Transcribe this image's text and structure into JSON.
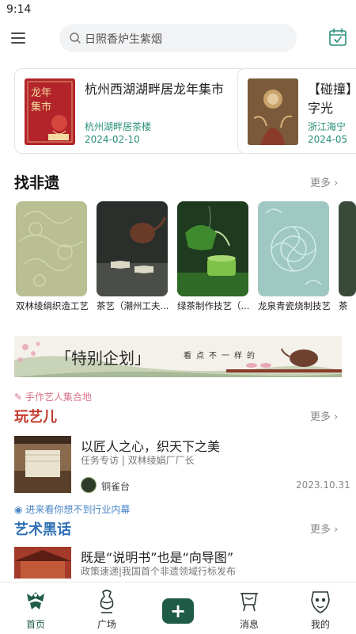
{
  "status_bar": {
    "time": "9:14"
  },
  "search": {
    "placeholder_text": "日照香炉生紫烟"
  },
  "events": [
    {
      "title": "杭州西湖湖畔居龙年集市",
      "venue": "杭州湖畔居茶楼",
      "date": "2024-02-10"
    },
    {
      "title": "【碰撞】数字光",
      "venue": "浙江海宁",
      "date": "2024-05"
    }
  ],
  "heritage": {
    "title": "找非遗",
    "more": "更多",
    "items": [
      {
        "label": "双林绫绢织造工艺"
      },
      {
        "label": "茶艺（潮州工夫..."
      },
      {
        "label": "绿茶制作技艺（..."
      },
      {
        "label": "龙泉青瓷烧制技艺"
      },
      {
        "label": "茶"
      }
    ]
  },
  "banner": {
    "title": "「特别企划」",
    "subtitle": "看点不一样的"
  },
  "craft_section": {
    "tag": "手作艺人集合地",
    "title": "玩艺儿",
    "more": "更多",
    "article": {
      "title": "以匠人之心，织天下之美",
      "subtitle": "任务专访 | 双林绫娟厂厂长",
      "author": "铜雀台",
      "date": "2023.10.31"
    }
  },
  "jargon_section": {
    "tag": "进来看你想不到行业内幕",
    "title": "艺术黑话",
    "more": "更多",
    "article": {
      "title": "既是“说明书”也是“向导图”",
      "subtitle": "政策速递|我国首个非遗领域行标发布"
    }
  },
  "tab_bar": {
    "tabs": [
      {
        "label": "首页"
      },
      {
        "label": "广场"
      },
      {
        "label": "消息"
      },
      {
        "label": "我的"
      }
    ],
    "plus": "+"
  },
  "colors": {
    "accent_green": "#1f5c47",
    "teal_text": "#2a8f7a",
    "section_title_red": "#c0392b",
    "section_title_blue": "#2f6fb5"
  }
}
